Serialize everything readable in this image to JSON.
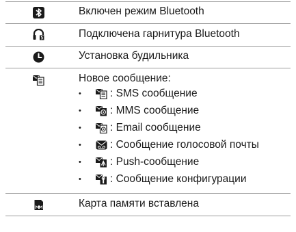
{
  "rows": [
    {
      "icon": "bluetooth-on-icon",
      "text": "Включен режим Bluetooth"
    },
    {
      "icon": "bluetooth-headset-icon",
      "text": "Подключена гарнитура Bluetooth"
    },
    {
      "icon": "alarm-clock-icon",
      "text": "Установка будильника"
    },
    {
      "icon": "new-message-icon",
      "text": "Новое сообщение:",
      "items": [
        {
          "icon": "sms-message-icon",
          "bullet": "•",
          "text": ": SMS сообщение"
        },
        {
          "icon": "mms-message-icon",
          "bullet": "•",
          "text": ": MMS сообщение"
        },
        {
          "icon": "email-message-icon",
          "bullet": "•",
          "text": ": Email сообщение"
        },
        {
          "icon": "voicemail-message-icon",
          "bullet": "•",
          "text": ": Сообщение голосовой почты"
        },
        {
          "icon": "push-message-icon",
          "bullet": "•",
          "text": ": Push-сообщение"
        },
        {
          "icon": "config-message-icon",
          "bullet": "•",
          "text": ": Сообщение конфигурации"
        }
      ]
    },
    {
      "icon": "memory-card-icon",
      "text": "Карта памяти вставлена"
    }
  ],
  "colors": {
    "icon": "#1a1a1a",
    "rule": "#9a9a9a",
    "text": "#1a1a1a"
  }
}
